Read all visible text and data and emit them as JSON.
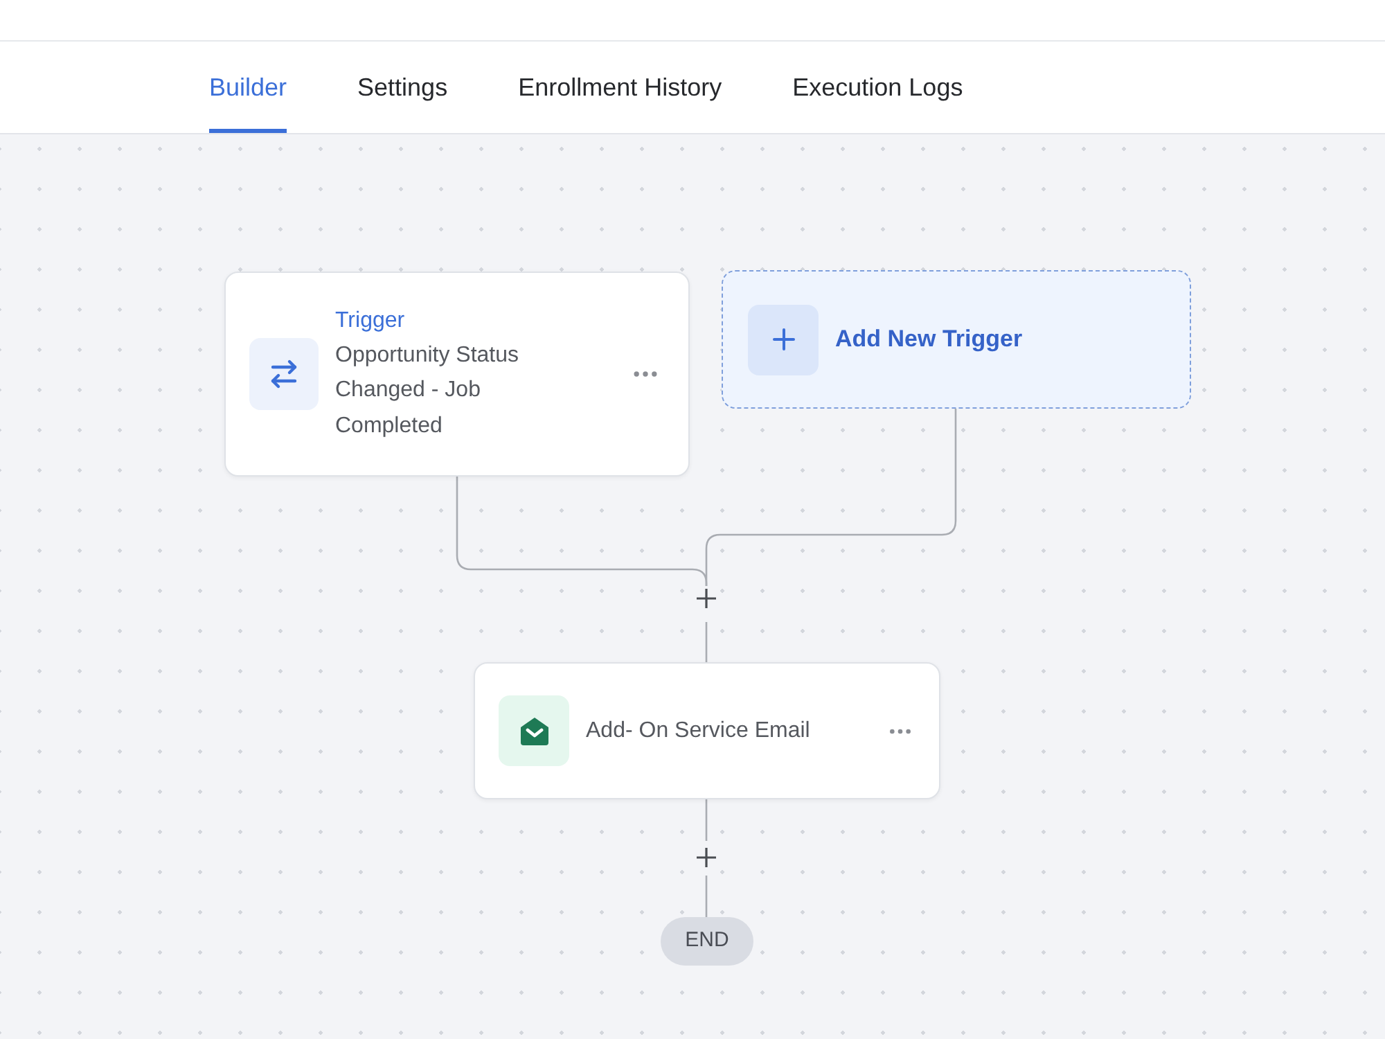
{
  "tabs": [
    {
      "label": "Builder",
      "selected": true
    },
    {
      "label": "Settings",
      "selected": false
    },
    {
      "label": "Enrollment History",
      "selected": false
    },
    {
      "label": "Execution Logs",
      "selected": false
    }
  ],
  "triggers": [
    {
      "kind": "trigger",
      "title": "Trigger",
      "description": "Opportunity Status Changed - Job Completed"
    },
    {
      "kind": "add",
      "label": "Add New Trigger"
    }
  ],
  "actions": [
    {
      "label": "Add- On Service Email"
    }
  ],
  "end": {
    "label": "END"
  }
}
